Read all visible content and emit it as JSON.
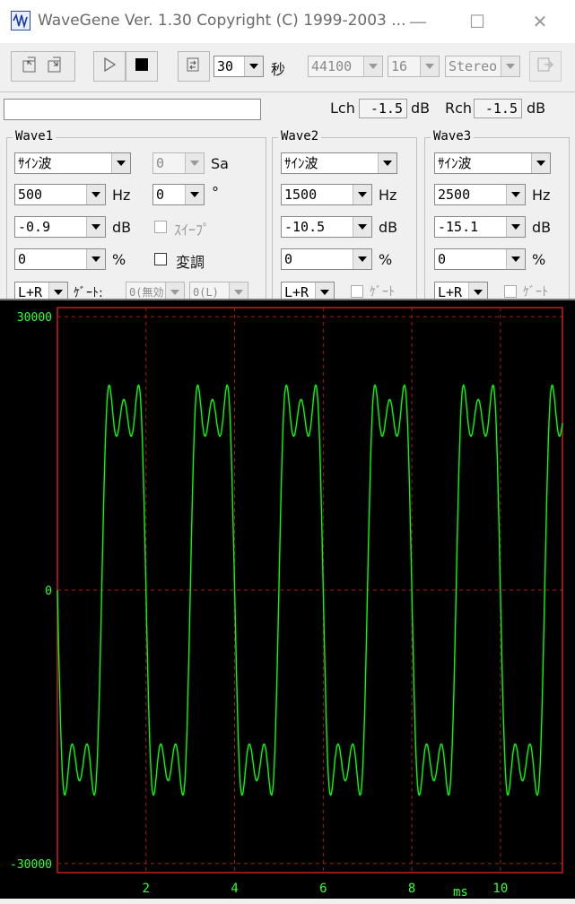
{
  "window": {
    "title": "WaveGene  Ver. 1.30  Copyright (C) 1999-2003 ...",
    "minimize": "—",
    "maximize": "☐",
    "close": "✕"
  },
  "toolbar": {
    "duration": "30",
    "duration_unit": "秒",
    "sample_rate": "44100",
    "bit_depth": "16",
    "channels": "Stereo",
    "icons": [
      "load-icon",
      "save-icon",
      "play-icon",
      "stop-icon",
      "loop-icon",
      "export-icon"
    ]
  },
  "levels": {
    "text_field": "",
    "lch_label": "Lch",
    "lch_value": "-1.5",
    "lch_unit": "dB",
    "rch_label": "Rch",
    "rch_value": "-1.5",
    "rch_unit": "dB"
  },
  "waves": [
    {
      "title": "Wave1",
      "type": "ｻｲﾝ波",
      "freq": "500",
      "freq_unit": "Hz",
      "level": "-0.9",
      "level_unit": "dB",
      "duty": "0",
      "duty_unit": "%",
      "channel": "L+R",
      "sa": "0",
      "sa_label": "Sa",
      "phase": "0",
      "phase_unit": "°",
      "sweep": "ｽｲｰﾌﾟ",
      "mod": "変調",
      "gate": "ｹﾞｰﾄ:",
      "gate_a": "0(無効)",
      "gate_b": "0(L)"
    },
    {
      "title": "Wave2",
      "type": "ｻｲﾝ波",
      "freq": "1500",
      "freq_unit": "Hz",
      "level": "-10.5",
      "level_unit": "dB",
      "duty": "0",
      "duty_unit": "%",
      "channel": "L+R",
      "gate": "ｹﾞｰﾄ"
    },
    {
      "title": "Wave3",
      "type": "ｻｲﾝ波",
      "freq": "2500",
      "freq_unit": "Hz",
      "level": "-15.1",
      "level_unit": "dB",
      "duty": "0",
      "duty_unit": "%",
      "channel": "L+R",
      "gate": "ｹﾞｰﾄ"
    }
  ],
  "colors": {
    "trace": "#00ff00",
    "grid": "#b01818",
    "frame": "#c81e1e",
    "labels": "#33ff33",
    "background": "#000000"
  },
  "chart_data": {
    "type": "line",
    "title": "",
    "xlabel": "ms",
    "ylabel": "",
    "xlim": [
      0,
      11.4
    ],
    "ylim": [
      -31000,
      31000
    ],
    "x_ticks": [
      2,
      4,
      6,
      8,
      10
    ],
    "y_ticks": [
      30000,
      0,
      -30000
    ],
    "grid": true,
    "series": [
      {
        "components": [
          {
            "freq_hz": 500,
            "level_db": -0.9
          },
          {
            "freq_hz": 1500,
            "level_db": -10.5
          },
          {
            "freq_hz": 2500,
            "level_db": -15.1
          }
        ]
      }
    ]
  }
}
